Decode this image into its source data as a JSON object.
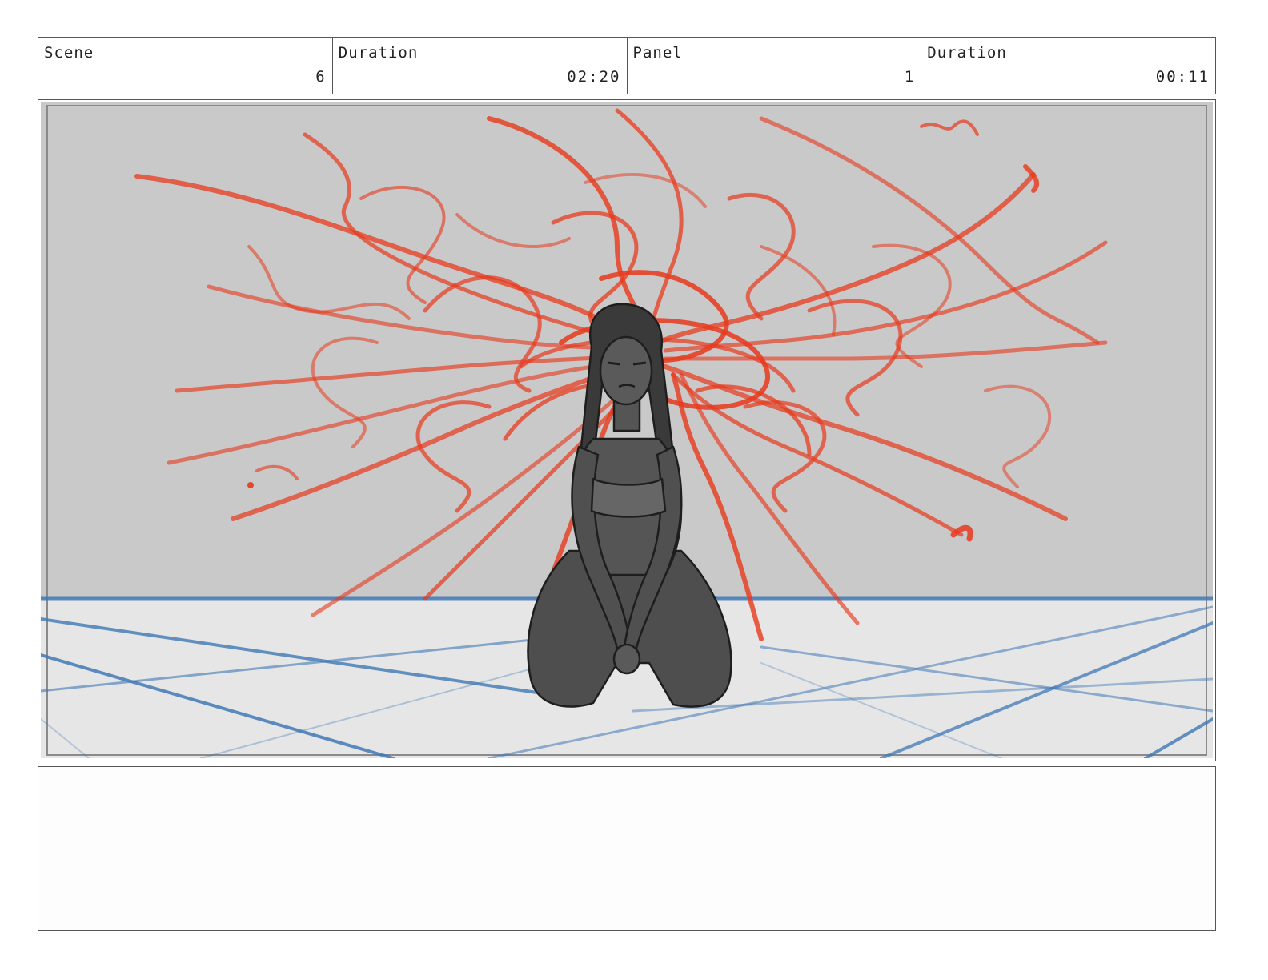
{
  "header": {
    "scene_label": "Scene",
    "scene_value": "6",
    "scene_duration_label": "Duration",
    "scene_duration_value": "02:20",
    "panel_label": "Panel",
    "panel_value": "1",
    "panel_duration_label": "Duration",
    "panel_duration_value": "00:11"
  },
  "notes": {
    "text": ""
  },
  "colors": {
    "wall": "#c9c9c9",
    "floor": "#e6e6e6",
    "scribble": "#e8391c",
    "grid": "#3f78b5",
    "figure": "#4e4e4e"
  }
}
